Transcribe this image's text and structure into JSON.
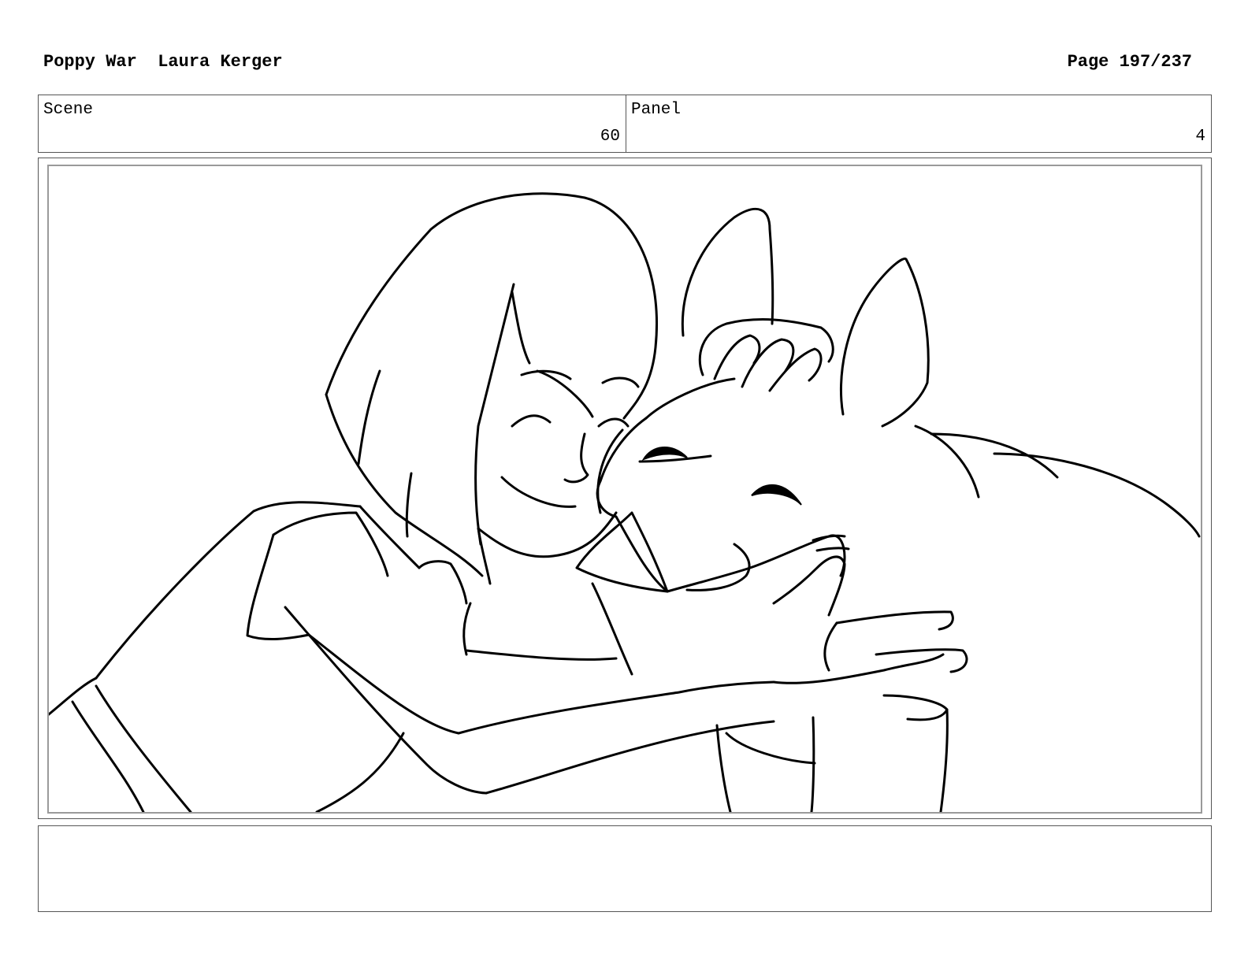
{
  "header": {
    "project_title": "Poppy War",
    "author": "Laura Kerger",
    "page_label": "Page 197/237"
  },
  "info": {
    "scene_label": "Scene",
    "scene_number": "60",
    "panel_label": "Panel",
    "panel_number": "4"
  },
  "notes": {
    "text": ""
  }
}
